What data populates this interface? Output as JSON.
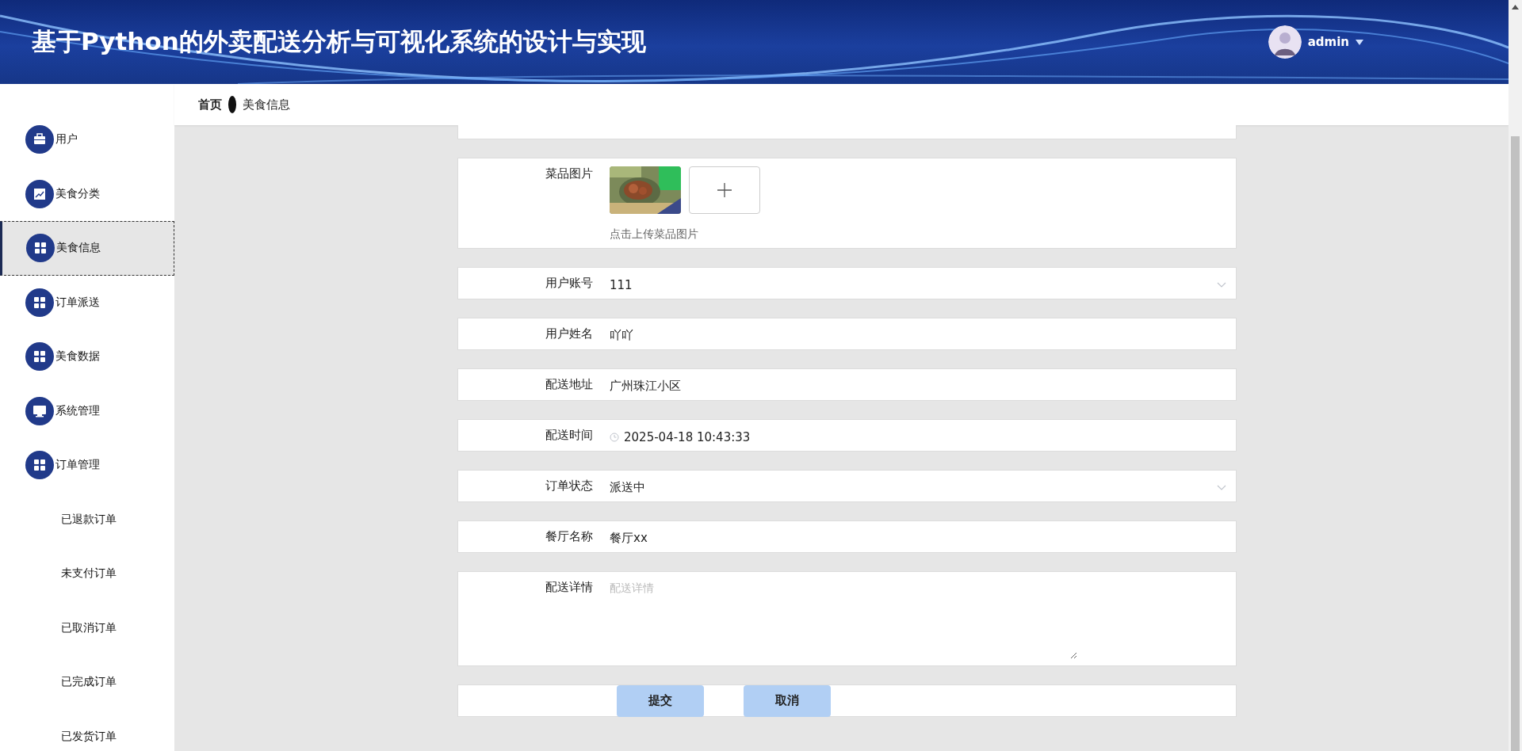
{
  "header": {
    "title": "基于Python的外卖配送分析与可视化系统的设计与实现",
    "user": {
      "name": "admin"
    }
  },
  "sidebar": {
    "items": [
      {
        "label": "用户",
        "selected": false
      },
      {
        "label": "美食分类",
        "selected": false
      },
      {
        "label": "美食信息",
        "selected": true
      },
      {
        "label": "订单派送",
        "selected": false
      },
      {
        "label": "美食数据",
        "selected": false
      },
      {
        "label": "系统管理",
        "selected": false
      },
      {
        "label": "订单管理",
        "selected": false,
        "expanded": true,
        "children": [
          {
            "label": "已退款订单",
            "selected": false
          },
          {
            "label": "未支付订单",
            "selected": false
          },
          {
            "label": "已取消订单",
            "selected": false
          },
          {
            "label": "已完成订单",
            "selected": false
          },
          {
            "label": "已发货订单",
            "selected": false
          }
        ]
      }
    ]
  },
  "breadcrumb": [
    {
      "label": "首页",
      "kind": "home"
    },
    {
      "label": "美食信息",
      "kind": "current"
    }
  ],
  "form": {
    "fields": [
      {
        "label": "菜品图片",
        "hint": "点击上传菜品图片"
      },
      {
        "kind": "select",
        "label": "用户账号",
        "value": "111"
      },
      {
        "kind": "text",
        "label": "用户姓名",
        "value": "吖吖"
      },
      {
        "kind": "text",
        "label": "配送地址",
        "value": "广州珠江小区"
      },
      {
        "kind": "datetime",
        "label": "配送时间",
        "value": "2025-04-18 10:43:33"
      },
      {
        "kind": "select",
        "label": "订单状态",
        "value": "派送中"
      },
      {
        "kind": "text",
        "label": "餐厅名称",
        "value": "餐厅xx"
      },
      {
        "kind": "textarea",
        "label": "配送详情",
        "placeholder": "配送详情"
      }
    ],
    "buttons": [
      {
        "label": "提交"
      },
      {
        "label": "取消"
      }
    ]
  }
}
